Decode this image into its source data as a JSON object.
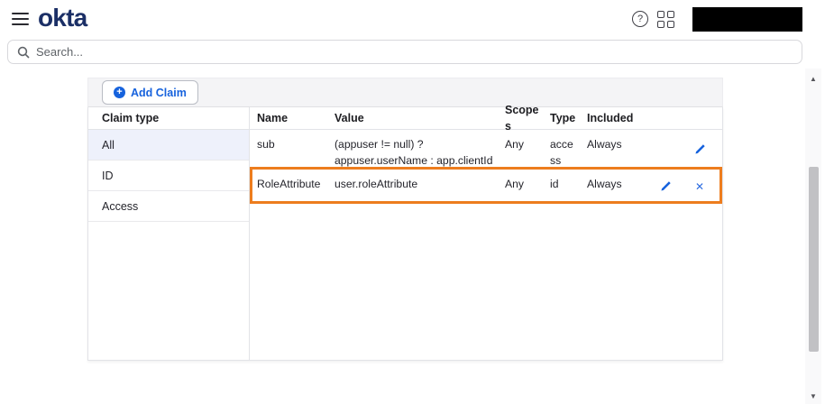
{
  "header": {
    "logo_text": "okta",
    "help_glyph": "?",
    "redacted_account_area": true
  },
  "search": {
    "placeholder": "Search..."
  },
  "toolbar": {
    "add_claim_label": "Add Claim",
    "plus_glyph": "+"
  },
  "claim_types": {
    "header": "Claim type",
    "items": [
      {
        "label": "All",
        "selected": true
      },
      {
        "label": "ID",
        "selected": false
      },
      {
        "label": "Access",
        "selected": false
      }
    ]
  },
  "claims_table": {
    "columns": {
      "name": "Name",
      "value": "Value",
      "scopes": "Scopes",
      "type": "Type",
      "included": "Included"
    },
    "rows": [
      {
        "name": "sub",
        "value": "(appuser != null) ? appuser.userName : app.clientId",
        "scopes": "Any",
        "type": "access",
        "included": "Always",
        "actions": [
          "edit"
        ],
        "highlighted": false
      },
      {
        "name": "RoleAttribute",
        "value": "user.roleAttribute",
        "scopes": "Any",
        "type": "id",
        "included": "Always",
        "actions": [
          "edit",
          "delete"
        ],
        "highlighted": true
      }
    ]
  },
  "icons": {
    "close_glyph": "✕",
    "scroll_up_glyph": "▲",
    "scroll_down_glyph": "▼"
  },
  "colors": {
    "accent_blue": "#1662dd",
    "highlight_orange": "#ed7d1e",
    "selected_row_bg": "#eef1fb",
    "logo_navy": "#1b2f66",
    "toolbar_bg": "#f4f4f6"
  }
}
